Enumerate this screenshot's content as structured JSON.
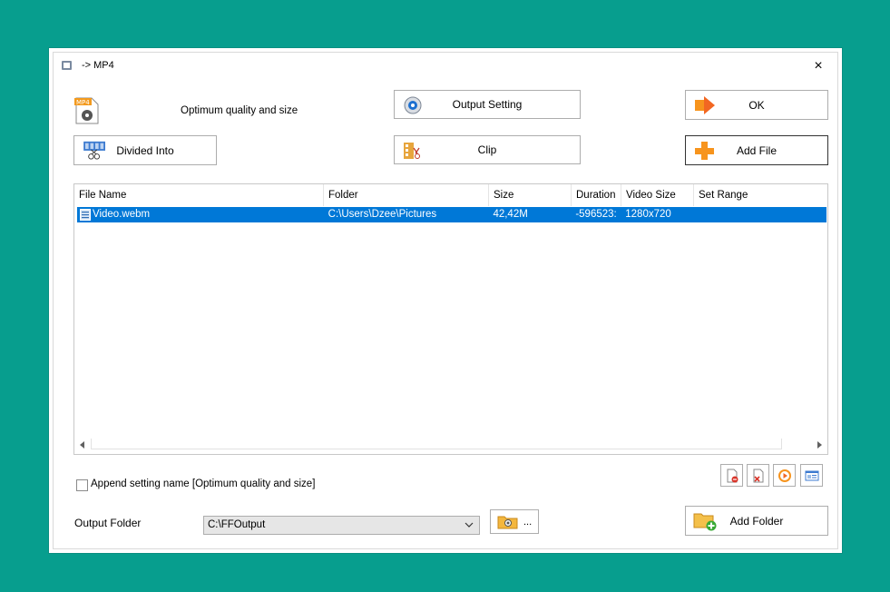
{
  "window": {
    "title": "-> MP4",
    "close_glyph": "×"
  },
  "quality_label": "Optimum quality and size",
  "buttons": {
    "output_setting": "Output Setting",
    "ok": "OK",
    "divided_into": "Divided Into",
    "clip": "Clip",
    "add_file": "Add File",
    "add_folder": "Add Folder"
  },
  "file_list": {
    "columns": [
      "File Name",
      "Folder",
      "Size",
      "Duration",
      "Video Size",
      "Set Range"
    ],
    "rows": [
      {
        "file_name": "Video.webm",
        "folder": "C:\\Users\\Dzee\\Pictures",
        "size": "42,42M",
        "duration": "-596523:",
        "video_size": "1280x720",
        "set_range": ""
      }
    ]
  },
  "append_setting": {
    "label": "Append setting name [Optimum quality and size]",
    "checked": false
  },
  "output": {
    "label": "Output Folder",
    "value": "C:\\FFOutput",
    "browse_dots": "..."
  },
  "colors": {
    "background": "#079e8e",
    "selection": "#0078d7",
    "accent_orange": "#f7941d"
  },
  "icons": [
    "mp4-file-icon",
    "gear-icon",
    "arrow-right-icon",
    "film-scissors-icon",
    "clip-icon",
    "plus-icon",
    "folder-add-icon",
    "remove-file-icon",
    "delete-icon",
    "play-icon",
    "info-icon",
    "folder-browse-icon"
  ]
}
